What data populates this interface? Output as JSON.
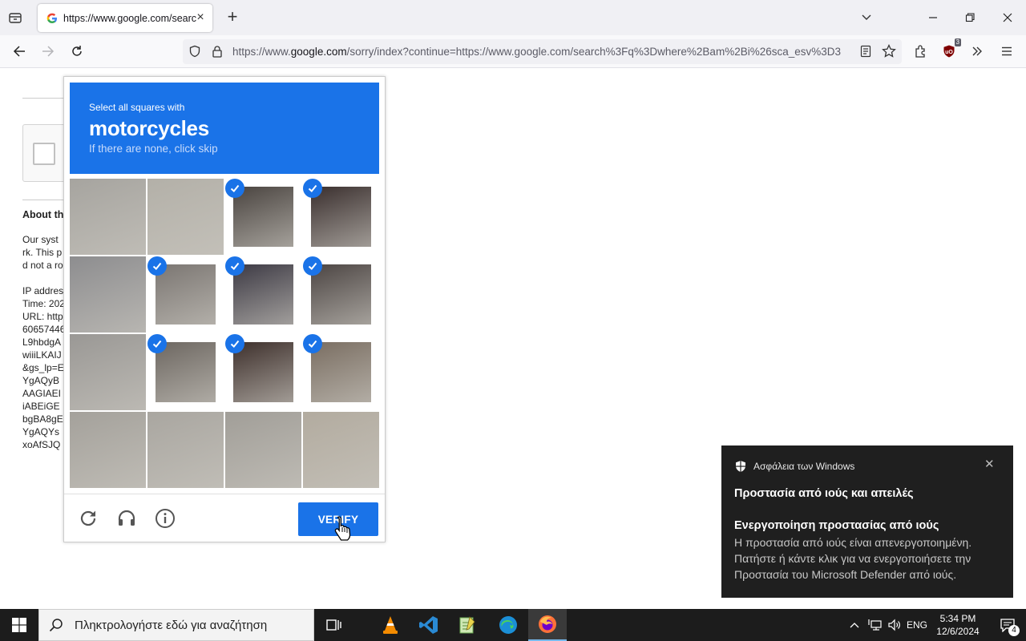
{
  "browser": {
    "tab_title": "https://www.google.com/search?q=where+am+i",
    "url_prefix": "https://www.",
    "url_domain": "google.com",
    "url_rest": "/sorry/index?continue=https://www.google.com/search%3Fq%3Dwhere%2Bam%2Bi%26sca_esv%3D3",
    "extension_badge": "3"
  },
  "page": {
    "about_heading": "About th",
    "lines": [
      "Our syst",
      "rk. This p",
      "d not a ro",
      "",
      "IP addres",
      "Time: 202",
      "URL: http",
      "60657446",
      "L9hbdgA",
      "wiiiLKAIJ",
      "&gs_lp=E",
      "YgAQyB",
      "AAGIAEI",
      "iABEiGE",
      "bgBA8gE",
      "YgAQYs",
      "xoAfSJQ"
    ]
  },
  "captcha": {
    "instruction": "Select all squares with",
    "target": "motorcycles",
    "hint": "If there are none, click skip",
    "verify_label": "VERIFY",
    "tiles": [
      {
        "selected": false,
        "color": "#a6a49f"
      },
      {
        "selected": false,
        "color": "#b3b0a8"
      },
      {
        "selected": true,
        "color": "#4a4440"
      },
      {
        "selected": true,
        "color": "#3a2f2e"
      },
      {
        "selected": false,
        "color": "#8d8d8f"
      },
      {
        "selected": true,
        "color": "#7b7672"
      },
      {
        "selected": true,
        "color": "#3d3a44"
      },
      {
        "selected": true,
        "color": "#4c4543"
      },
      {
        "selected": false,
        "color": "#9a9895"
      },
      {
        "selected": true,
        "color": "#6d6761"
      },
      {
        "selected": true,
        "color": "#3e302c"
      },
      {
        "selected": true,
        "color": "#7a6e62"
      },
      {
        "selected": false,
        "color": "#a4a19b"
      },
      {
        "selected": false,
        "color": "#a9a6a0"
      },
      {
        "selected": false,
        "color": "#a19e98"
      },
      {
        "selected": false,
        "color": "#b2ab9f"
      }
    ]
  },
  "toast": {
    "app": "Ασφάλεια των Windows",
    "title": "Προστασία από ιούς και απειλές",
    "heading": "Ενεργοποίηση προστασίας από ιούς",
    "body": "Η προστασία από ιούς είναι απενεργοποιημένη. Πατήστε ή κάντε κλικ για να ενεργοποιήσετε την Προστασία του Microsoft Defender από ιούς."
  },
  "taskbar": {
    "search_placeholder": "Πληκτρολογήστε εδώ για αναζήτηση",
    "language": "ENG",
    "time": "5:34 PM",
    "date": "12/6/2024",
    "notification_count": "4"
  },
  "colors": {
    "accent": "#1a73e8",
    "toast_bg": "#1f1f1f",
    "taskbar_bg": "#1c1c1c"
  }
}
